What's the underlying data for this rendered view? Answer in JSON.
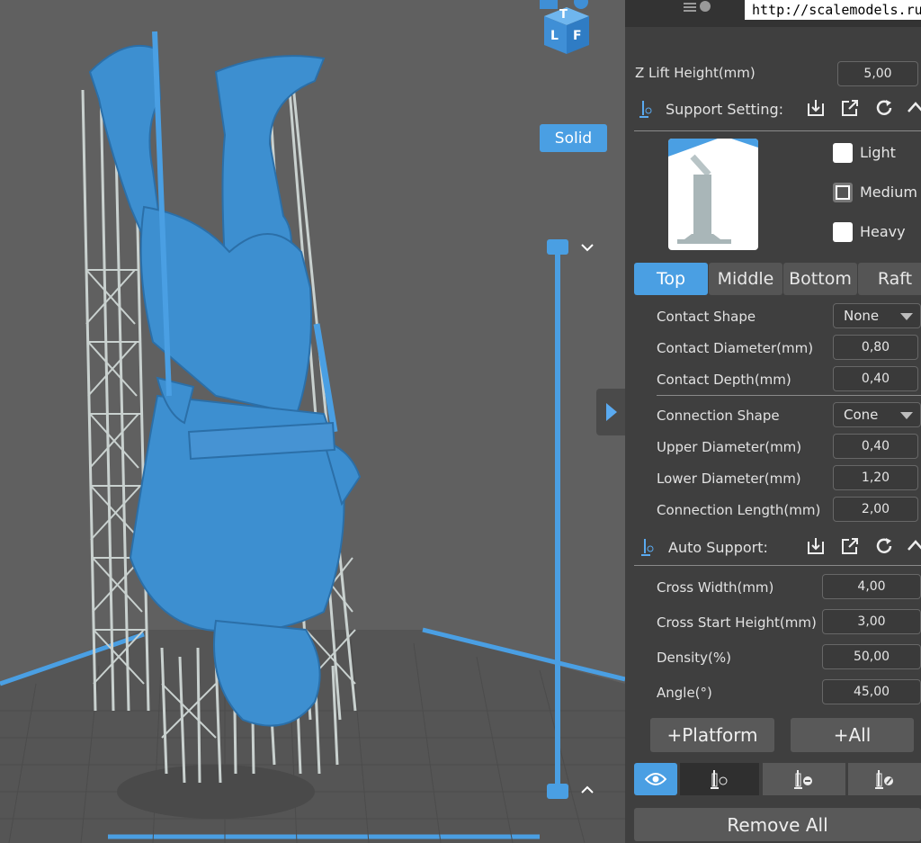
{
  "viewport": {
    "view_mode_label": "Solid",
    "view_cube_faces": [
      "T",
      "L",
      "F"
    ],
    "watermark": "http://scalemodels.ru"
  },
  "panel": {
    "z_lift": {
      "label": "Z Lift Height(mm)",
      "value": "5,00"
    },
    "support_setting": {
      "label": "Support Setting:"
    },
    "density_options": [
      {
        "label": "Light",
        "checked": false
      },
      {
        "label": "Medium",
        "checked": true
      },
      {
        "label": "Heavy",
        "checked": false
      }
    ],
    "tabs": [
      {
        "label": "Top",
        "active": true
      },
      {
        "label": "Middle",
        "active": false
      },
      {
        "label": "Bottom",
        "active": false
      },
      {
        "label": "Raft",
        "active": false
      }
    ],
    "contact_shape": {
      "label": "Contact Shape",
      "value": "None"
    },
    "contact_diameter": {
      "label": "Contact Diameter(mm)",
      "value": "0,80"
    },
    "contact_depth": {
      "label": "Contact Depth(mm)",
      "value": "0,40"
    },
    "connection_shape": {
      "label": "Connection Shape",
      "value": "Cone"
    },
    "upper_diameter": {
      "label": "Upper Diameter(mm)",
      "value": "0,40"
    },
    "lower_diameter": {
      "label": "Lower Diameter(mm)",
      "value": "1,20"
    },
    "connection_length": {
      "label": "Connection Length(mm)",
      "value": "2,00"
    },
    "auto_support": {
      "label": "Auto Support:"
    },
    "cross_width": {
      "label": "Cross Width(mm)",
      "value": "4,00"
    },
    "cross_start_height": {
      "label": "Cross Start Height(mm)",
      "value": "3,00"
    },
    "density": {
      "label": "Density(%)",
      "value": "50,00"
    },
    "angle": {
      "label": "Angle(°)",
      "value": "45,00"
    },
    "buttons": {
      "platform": "+Platform",
      "all": "+All",
      "remove_all": "Remove All"
    }
  },
  "colors": {
    "accent": "#4a9fe3",
    "model": "#3d8fd0",
    "panel_bg": "#3f3f3f",
    "viewport_bg": "#606060",
    "support": "#c9d1cf"
  }
}
